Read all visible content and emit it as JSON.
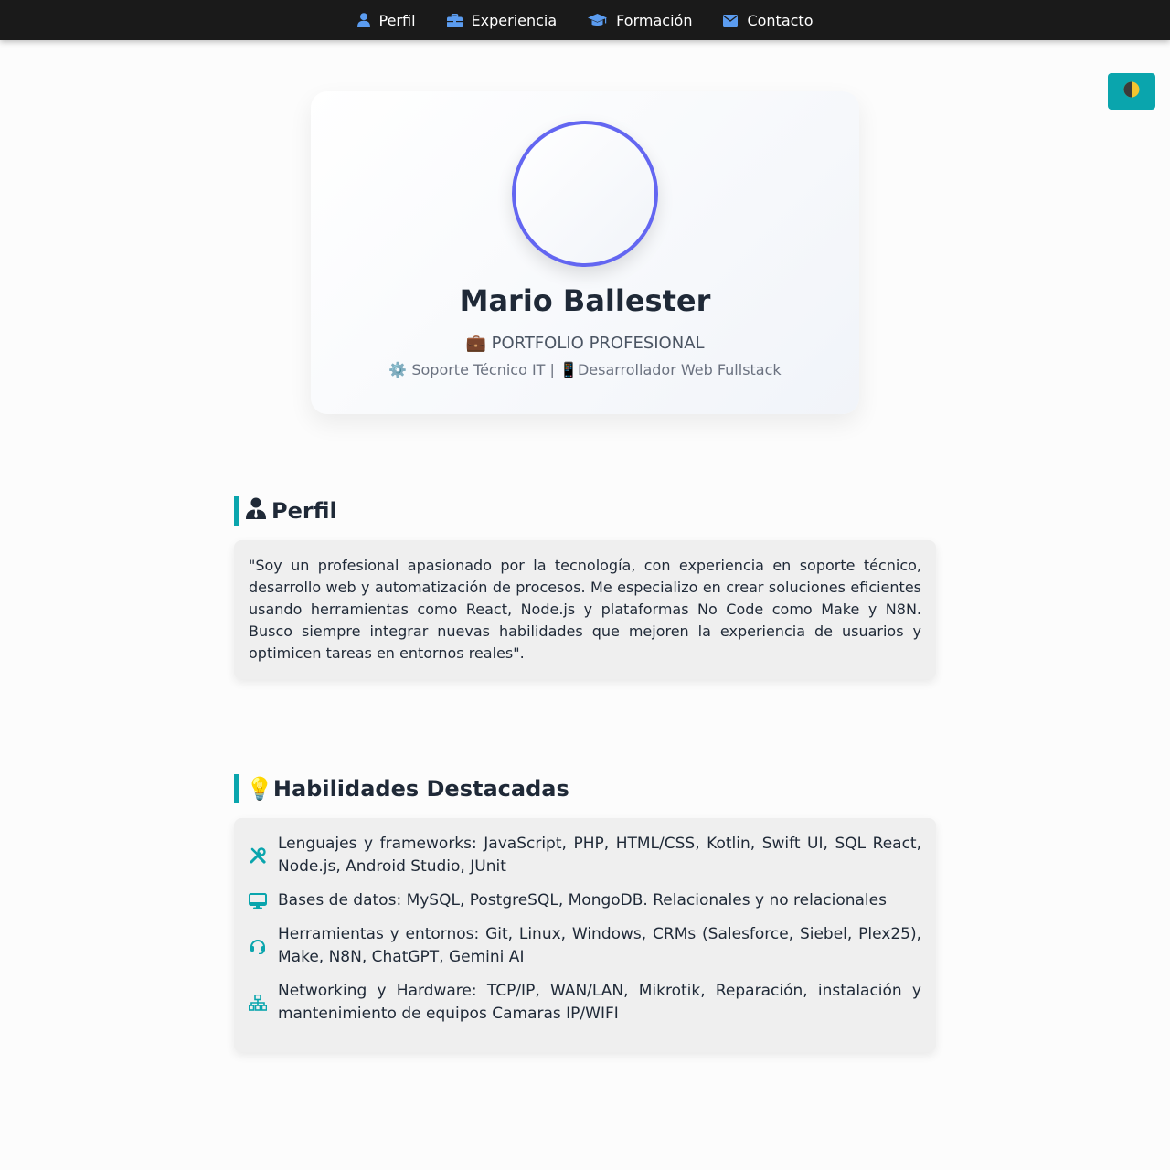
{
  "nav": {
    "items": [
      {
        "label": "Perfil",
        "icon": "user-icon"
      },
      {
        "label": "Experiencia",
        "icon": "briefcase-icon"
      },
      {
        "label": "Formación",
        "icon": "graduation-cap-icon"
      },
      {
        "label": "Contacto",
        "icon": "envelope-icon"
      }
    ],
    "icon_color": "#5b9cf0"
  },
  "theme_toggle": {
    "icon": "half-moon-icon",
    "color": "#0aa5ad"
  },
  "hero": {
    "name": "Mario Ballester",
    "subtitle": "💼 PORTFOLIO PROFESIONAL",
    "roles": "⚙️ Soporte Técnico IT | 📱Desarrollador Web Fullstack",
    "avatar_border_color": "#6366f1"
  },
  "profile": {
    "title": "Perfil",
    "icon": "user-tie-icon",
    "text": "\"Soy un profesional apasionado por la tecnología, con experiencia en soporte técnico, desarrollo web y automatización de procesos. Me especializo en crear soluciones eficientes usando herramientas como React, Node.js y plataformas No Code como Make y N8N. Busco siempre integrar nuevas habilidades que mejoren la experiencia de usuarios y optimicen tareas en entornos reales\"."
  },
  "skills": {
    "title": "💡Habilidades Destacadas",
    "accent_color": "#0aa5ad",
    "items": [
      {
        "icon": "tools-icon",
        "text": "Lenguajes y frameworks: JavaScript, PHP, HTML/CSS, Kotlin, Swift UI, SQL React, Node.js, Android Studio, JUnit"
      },
      {
        "icon": "desktop-icon",
        "text": "Bases de datos: MySQL, PostgreSQL, MongoDB. Relacionales y no relacionales"
      },
      {
        "icon": "headset-icon",
        "text": "Herramientas y entornos: Git, Linux, Windows, CRMs (Salesforce, Siebel, Plex25), Make, N8N, ChatGPT, Gemini AI"
      },
      {
        "icon": "network-icon",
        "text": "Networking y Hardware: TCP/IP, WAN/LAN, Mikrotik, Reparación, instalación y mantenimiento de equipos Camaras IP/WIFI"
      }
    ]
  }
}
